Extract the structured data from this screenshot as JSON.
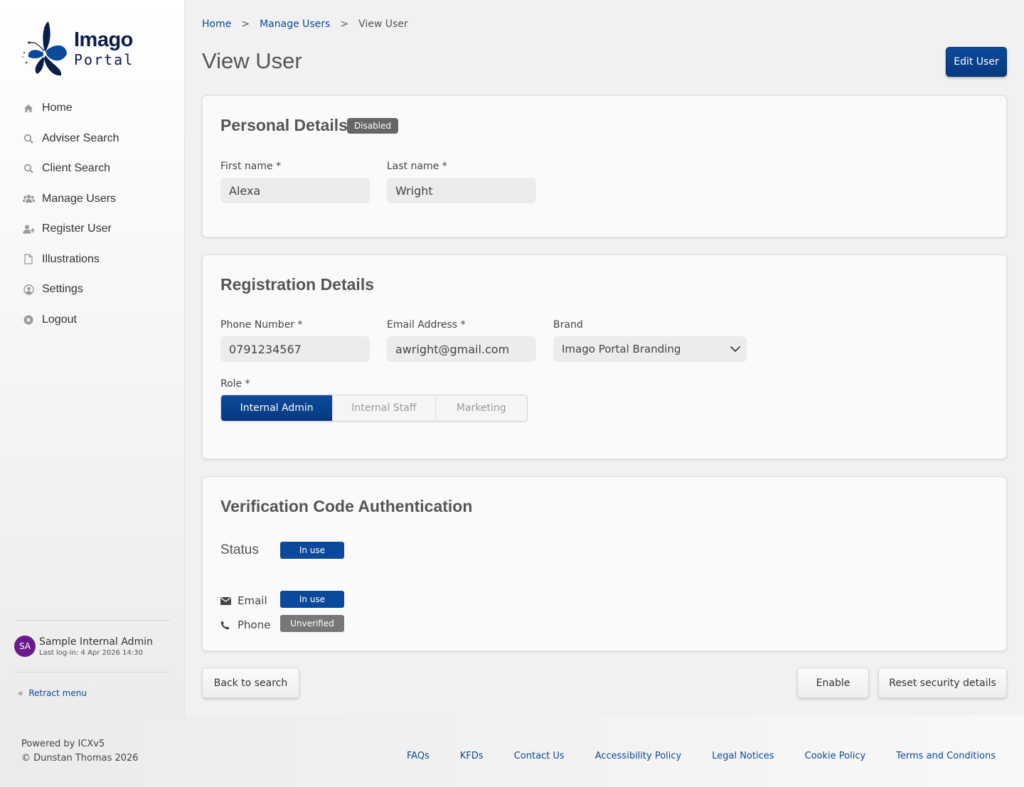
{
  "brand": {
    "name_line1": "Imago",
    "name_line2": "Portal",
    "primary_color": "#0b4a9a"
  },
  "sidebar": {
    "items": [
      {
        "label": "Home",
        "icon": "home-icon"
      },
      {
        "label": "Adviser Search",
        "icon": "search-icon"
      },
      {
        "label": "Client Search",
        "icon": "search-icon"
      },
      {
        "label": "Manage Users",
        "icon": "users-icon"
      },
      {
        "label": "Register User",
        "icon": "user-plus-icon"
      },
      {
        "label": "Illustrations",
        "icon": "file-icon"
      },
      {
        "label": "Settings",
        "icon": "user-circle-icon"
      },
      {
        "label": "Logout",
        "icon": "close-circle-icon"
      }
    ],
    "user": {
      "initials": "SA",
      "name": "Sample Internal Admin",
      "last_login": "Last log-in: 4 Apr 2026 14:30"
    },
    "retract_label": "Retract menu"
  },
  "breadcrumb": {
    "home": "Home",
    "manage": "Manage Users",
    "current": "View User",
    "separator": ">"
  },
  "page": {
    "title": "View User",
    "edit_button": "Edit User"
  },
  "personal": {
    "title": "Personal Details",
    "status_badge": "Disabled",
    "first_name_label": "First name",
    "first_name_value": "Alexa",
    "last_name_label": "Last name",
    "last_name_value": "Wright",
    "required_mark": "*"
  },
  "registration": {
    "title": "Registration Details",
    "phone_label": "Phone Number",
    "phone_value": "0791234567",
    "email_label": "Email Address",
    "email_value": "awright@gmail.com",
    "brand_label": "Brand",
    "brand_value": "Imago Portal Branding",
    "role_label": "Role",
    "roles": [
      "Internal Admin",
      "Internal Staff",
      "Marketing"
    ],
    "selected_role": "Internal Admin"
  },
  "verification": {
    "title": "Verification Code Authentication",
    "status_label": "Status",
    "status_value": "In use",
    "email_label": "Email",
    "email_status": "In use",
    "phone_label": "Phone",
    "phone_status": "Unverified"
  },
  "actions": {
    "back": "Back to search",
    "enable": "Enable",
    "reset": "Reset security details"
  },
  "footer": {
    "powered": "Powered by ICXv5",
    "copyright": "© Dunstan Thomas 2026",
    "links": [
      "FAQs",
      "KFDs",
      "Contact Us",
      "Accessibility Policy",
      "Legal Notices",
      "Cookie Policy",
      "Terms and Conditions"
    ]
  }
}
